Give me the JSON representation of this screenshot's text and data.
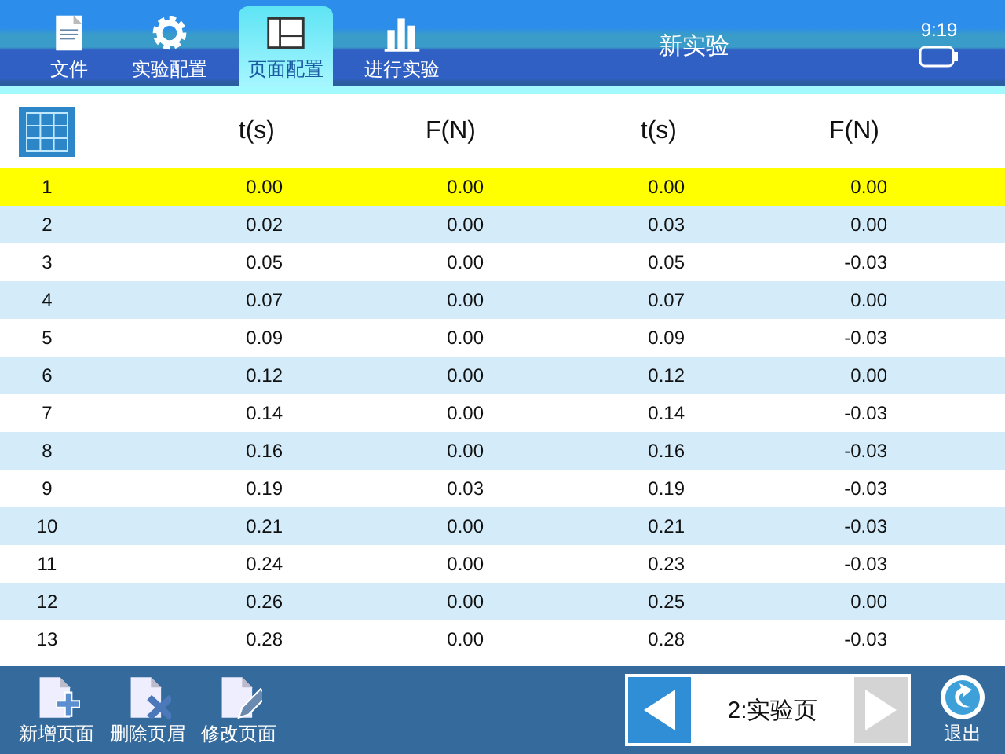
{
  "tabs": [
    {
      "label": "文件",
      "kind": "file",
      "selected": false
    },
    {
      "label": "实验配置",
      "kind": "gear",
      "selected": false
    },
    {
      "label": "页面配置",
      "kind": "layout",
      "selected": true
    },
    {
      "label": "进行实验",
      "kind": "chart",
      "selected": false
    }
  ],
  "window": {
    "title": "新实验",
    "time": "9:19"
  },
  "table": {
    "columns": [
      "t(s)",
      "F(N)",
      "t(s)",
      "F(N)"
    ],
    "rows": [
      {
        "index": "1",
        "cells": [
          "0.00",
          "0.00",
          "0.00",
          "0.00"
        ],
        "selected": true
      },
      {
        "index": "2",
        "cells": [
          "0.02",
          "0.00",
          "0.03",
          "0.00"
        ],
        "selected": false
      },
      {
        "index": "3",
        "cells": [
          "0.05",
          "0.00",
          "0.05",
          "-0.03"
        ],
        "selected": false
      },
      {
        "index": "4",
        "cells": [
          "0.07",
          "0.00",
          "0.07",
          "0.00"
        ],
        "selected": false
      },
      {
        "index": "5",
        "cells": [
          "0.09",
          "0.00",
          "0.09",
          "-0.03"
        ],
        "selected": false
      },
      {
        "index": "6",
        "cells": [
          "0.12",
          "0.00",
          "0.12",
          "0.00"
        ],
        "selected": false
      },
      {
        "index": "7",
        "cells": [
          "0.14",
          "0.00",
          "0.14",
          "-0.03"
        ],
        "selected": false
      },
      {
        "index": "8",
        "cells": [
          "0.16",
          "0.00",
          "0.16",
          "-0.03"
        ],
        "selected": false
      },
      {
        "index": "9",
        "cells": [
          "0.19",
          "0.03",
          "0.19",
          "-0.03"
        ],
        "selected": false
      },
      {
        "index": "10",
        "cells": [
          "0.21",
          "0.00",
          "0.21",
          "-0.03"
        ],
        "selected": false
      },
      {
        "index": "11",
        "cells": [
          "0.24",
          "0.00",
          "0.23",
          "-0.03"
        ],
        "selected": false
      },
      {
        "index": "12",
        "cells": [
          "0.26",
          "0.00",
          "0.25",
          "0.00"
        ],
        "selected": false
      },
      {
        "index": "13",
        "cells": [
          "0.28",
          "0.00",
          "0.28",
          "-0.03"
        ],
        "selected": false
      }
    ]
  },
  "toolbar": [
    {
      "label": "新增页面",
      "kind": "add"
    },
    {
      "label": "删除页眉",
      "kind": "delete"
    },
    {
      "label": "修改页面",
      "kind": "edit"
    }
  ],
  "pager": {
    "page": "2:实验页",
    "prev_disabled": false,
    "next_disabled": true
  },
  "exit": {
    "label": "退出"
  }
}
